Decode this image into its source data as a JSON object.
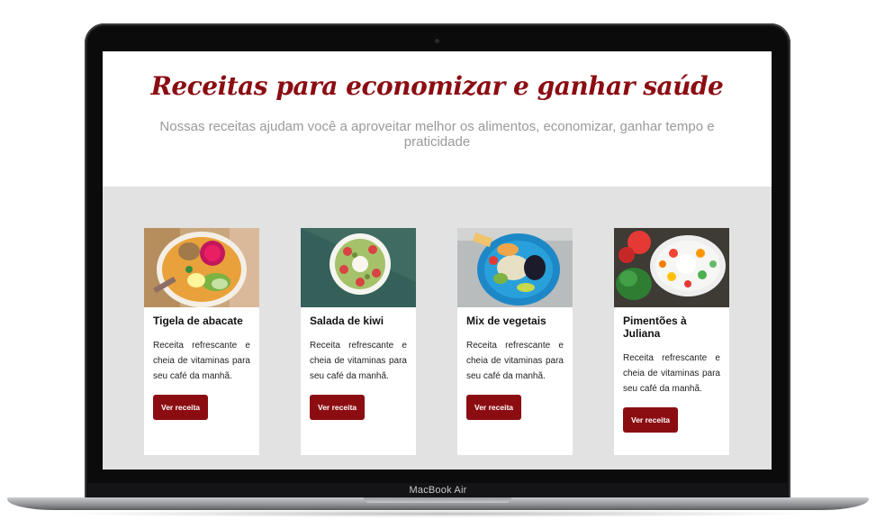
{
  "device": {
    "model_label": "MacBook Air"
  },
  "page": {
    "title": "Receitas para economizar e ganhar saúde",
    "subtitle": "Nossas receitas ajudam você a aproveitar melhor os alimentos, economizar, ganhar tempo e praticidade"
  },
  "recipes": [
    {
      "title": "Tigela de abacate",
      "description": "Receita refrescante e cheia de vitaminas para seu café da manhã.",
      "button": "Ver receita"
    },
    {
      "title": "Salada de kiwi",
      "description": "Receita refrescante e cheia de vitaminas para seu café da manhã.",
      "button": "Ver receita"
    },
    {
      "title": "Mix de vegetais",
      "description": "Receita refrescante e cheia de vitaminas para seu café da manhã.",
      "button": "Ver receita"
    },
    {
      "title": "Pimentões à Juliana",
      "description": "Receita refrescante e cheia de vitaminas para seu café da manhã.",
      "button": "Ver receita"
    }
  ],
  "colors": {
    "accent": "#8b0d12",
    "section_bg": "#e2e2e2"
  }
}
